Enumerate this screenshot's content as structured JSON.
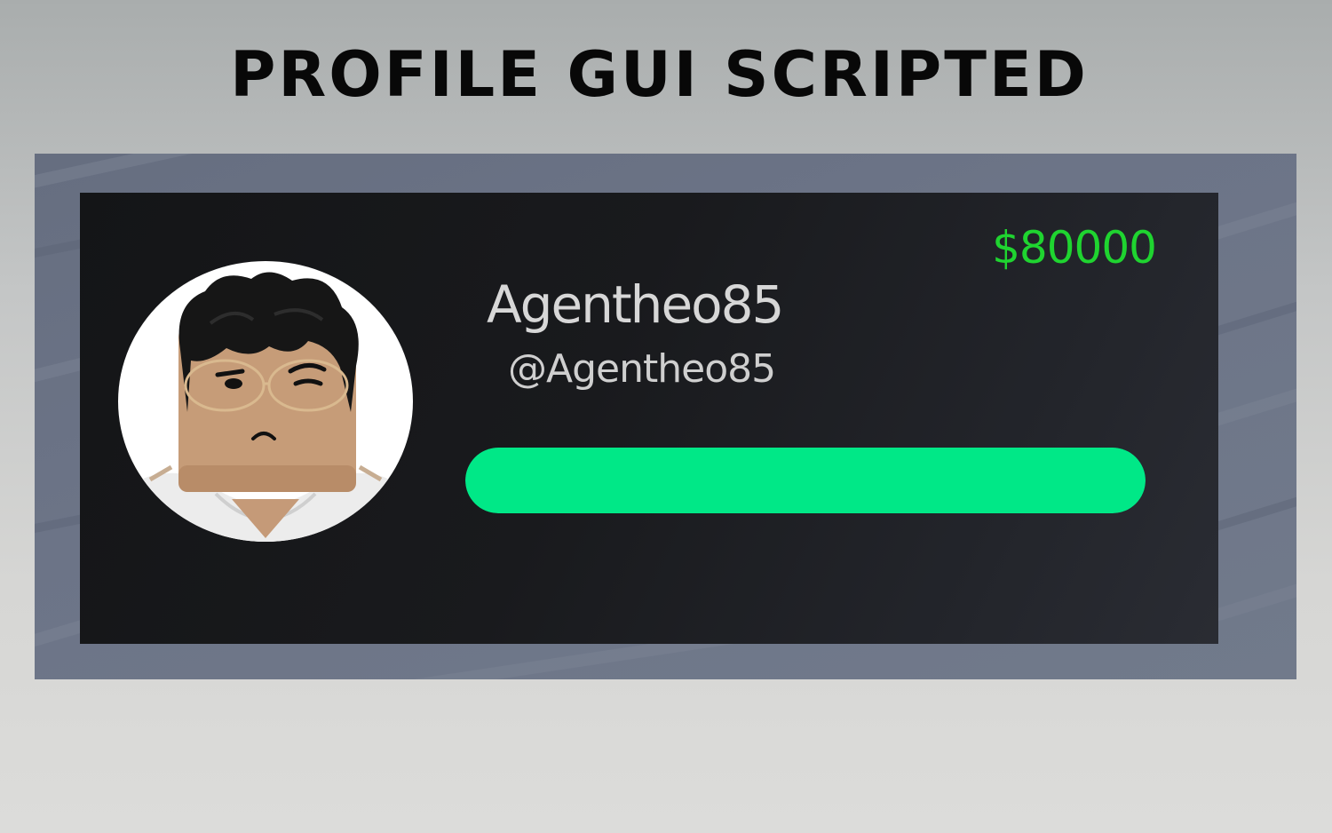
{
  "page": {
    "title": "PROFILE GUI SCRIPTED"
  },
  "profile": {
    "display_name": "Agentheo85",
    "username": "@Agentheo85",
    "money": "$80000",
    "progress": 1.0,
    "avatar_icon": "avatar-headshot-icon"
  },
  "colors": {
    "money": "#1fd430",
    "progress_fill": "#00e887",
    "card_background": "#18191c",
    "frame_background": "#6b7386",
    "page_background": "#c8caca"
  }
}
